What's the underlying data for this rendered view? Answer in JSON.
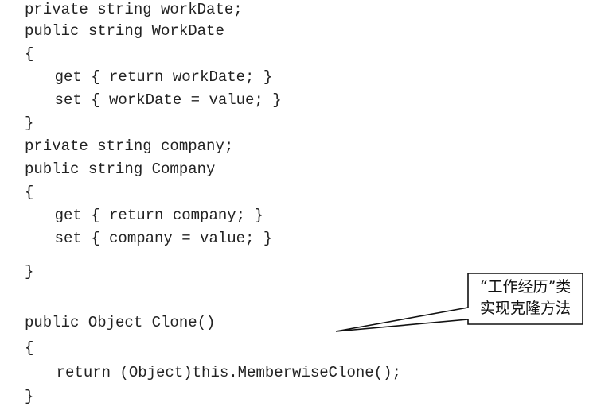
{
  "code": {
    "lines": [
      "private string workDate;",
      "public string WorkDate",
      "{",
      "    get { return workDate; }",
      "    set { workDate = value; }",
      "}",
      "private string company;",
      "public string Company",
      "{",
      "    get { return company; }",
      "    set { company = value; }",
      "}",
      "public Object Clone()",
      "{",
      "    return (Object)this.MemberwiseClone();",
      "}"
    ]
  },
  "callout": {
    "line1": "“工作经历”类",
    "line2": "实现克隆方法"
  }
}
